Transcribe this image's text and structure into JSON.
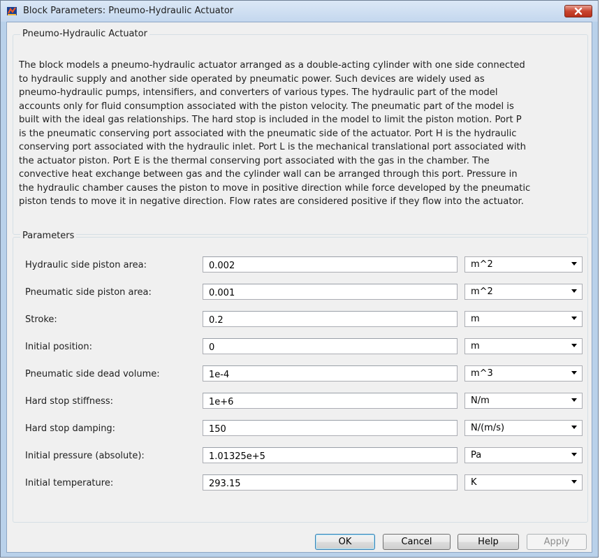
{
  "window": {
    "title": "Block Parameters: Pneumo-Hydraulic Actuator",
    "close_icon": "close-x-icon",
    "app_icon": "simulink-block-icon",
    "close_color": "#c9452f"
  },
  "description": {
    "group_title": "Pneumo-Hydraulic Actuator",
    "lines": [
      "The block models a pneumo-hydraulic actuator arranged as a double-acting cylinder with one side connected",
      "to hydraulic supply and another side operated by pneumatic power. Such devices are widely used as",
      "pneumo-hydraulic pumps, intensifiers, and converters of various types. The hydraulic part  of the model",
      "accounts only for fluid consumption associated with the piston velocity. The pneumatic part of the model is",
      "built with the ideal gas relationships. The hard stop is included in the model to limit the piston motion. Port P",
      "is the pneumatic conserving port associated with the pneumatic side of the actuator. Port H is the hydraulic",
      "conserving port associated with the hydraulic inlet. Port L is the mechanical translational port associated with",
      "the actuator piston. Port E is the thermal conserving port associated with the gas in the chamber. The",
      "convective heat exchange between gas and the cylinder wall can be arranged through this port. Pressure in",
      "the hydraulic chamber causes the piston to move in positive direction while force developed by the pneumatic",
      "piston tends to move it in negative direction. Flow rates are considered positive if they flow into the actuator."
    ]
  },
  "parameters": {
    "group_title": "Parameters",
    "rows": [
      {
        "label": "Hydraulic side piston area:",
        "value": "0.002",
        "unit": "m^2"
      },
      {
        "label": "Pneumatic side piston area:",
        "value": "0.001",
        "unit": "m^2"
      },
      {
        "label": "Stroke:",
        "value": "0.2",
        "unit": "m"
      },
      {
        "label": "Initial position:",
        "value": "0",
        "unit": "m"
      },
      {
        "label": "Pneumatic side dead volume:",
        "value": "1e-4",
        "unit": "m^3"
      },
      {
        "label": "Hard stop stiffness:",
        "value": "1e+6",
        "unit": "N/m"
      },
      {
        "label": "Hard stop damping:",
        "value": "150",
        "unit": "N/(m/s)"
      },
      {
        "label": "Initial pressure (absolute):",
        "value": "1.01325e+5",
        "unit": "Pa"
      },
      {
        "label": "Initial temperature:",
        "value": "293.15",
        "unit": "K"
      }
    ]
  },
  "buttons": {
    "ok": "OK",
    "cancel": "Cancel",
    "help": "Help",
    "apply": "Apply"
  }
}
